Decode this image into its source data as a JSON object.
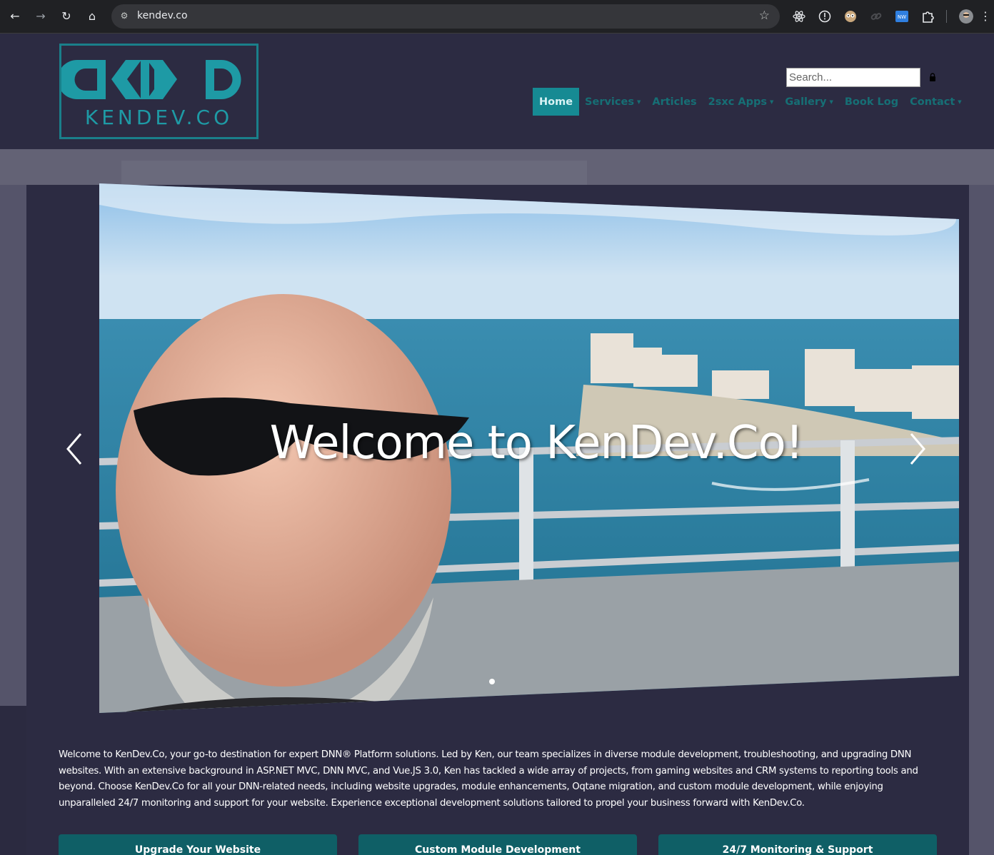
{
  "browser": {
    "url": "kendev.co",
    "back_glyph": "←",
    "forward_glyph": "→",
    "reload_glyph": "↻",
    "home_glyph": "⌂",
    "tune_glyph": "⚙",
    "star_glyph": "☆",
    "menu_glyph": "⋮",
    "extensions": [
      "react-devtools-icon",
      "info-icon",
      "owl-extension-icon",
      "link-extension-icon",
      "nw-extension-icon",
      "puzzle-icon",
      "profile-avatar"
    ]
  },
  "header": {
    "logo_text": "KENDEV.CO",
    "search_placeholder": "Search...",
    "nav": [
      {
        "label": "Home",
        "active": true,
        "caret": false
      },
      {
        "label": "Services",
        "active": false,
        "caret": true
      },
      {
        "label": "Articles",
        "active": false,
        "caret": false
      },
      {
        "label": "2sxc Apps",
        "active": false,
        "caret": true
      },
      {
        "label": "Gallery",
        "active": false,
        "caret": true
      },
      {
        "label": "Book Log",
        "active": false,
        "caret": false
      },
      {
        "label": "Contact",
        "active": false,
        "caret": true
      }
    ]
  },
  "hero": {
    "title": "Welcome to KenDev.Co!",
    "slide_count": 1,
    "active_slide": 1
  },
  "intro": {
    "text": "Welcome to KenDev.Co, your go-to destination for expert DNN® Platform solutions. Led by Ken, our team specializes in diverse module development, troubleshooting, and upgrading DNN websites. With an extensive background in ASP.NET MVC, DNN MVC, and Vue.JS 3.0, Ken has tackled a wide array of projects, from gaming websites and CRM systems to reporting tools and beyond. Choose KenDev.Co for all your DNN-related needs, including website upgrades, module enhancements, Oqtane migration, and custom module development, while enjoying unparalleled 24/7 monitoring and support for your website. Experience exceptional development solutions tailored to propel your business forward with KenDev.Co."
  },
  "cta": [
    {
      "label": "Upgrade Your Website"
    },
    {
      "label": "Custom Module Development"
    },
    {
      "label": "24/7 Monitoring & Support"
    }
  ],
  "colors": {
    "page_bg": "#2c2b42",
    "accent": "#168a93",
    "nav_text": "#166f75",
    "cta_bg": "#0f5f66"
  }
}
